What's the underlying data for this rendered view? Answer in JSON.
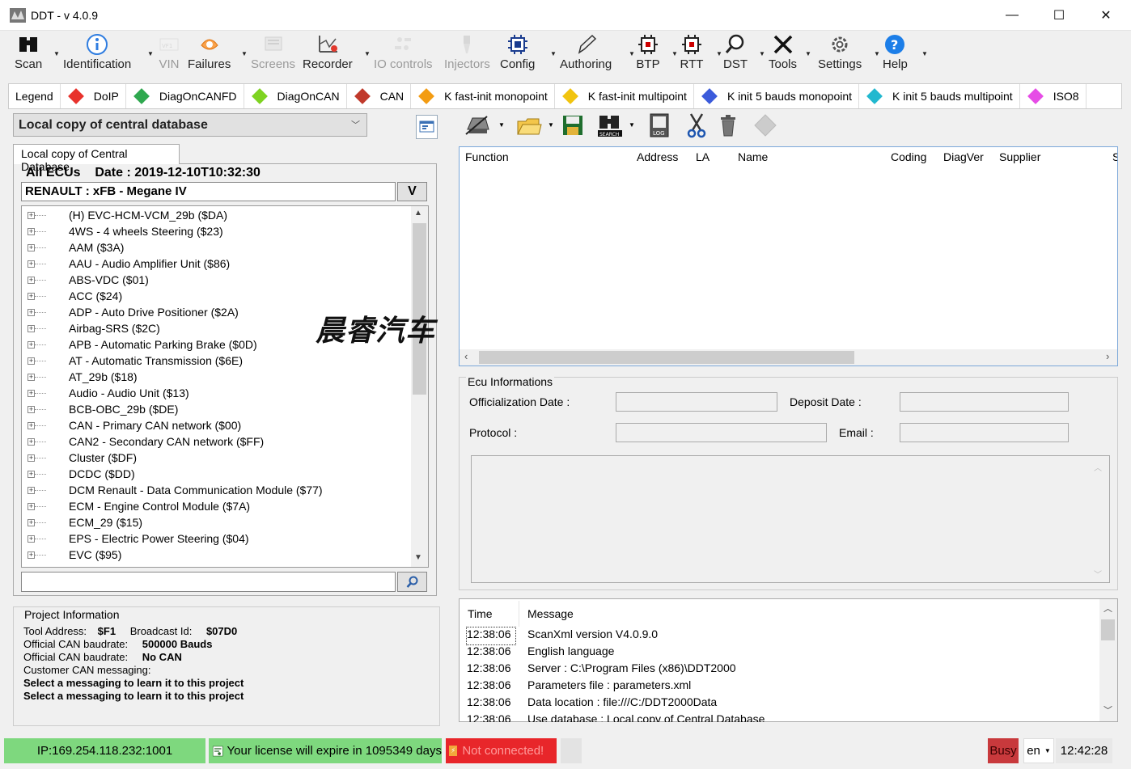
{
  "window": {
    "title": "DDT - v 4.0.9",
    "controls": {
      "minimize": "—",
      "maximize": "☐",
      "close": "✕"
    }
  },
  "toolbar": [
    {
      "label": "Scan",
      "icon": "binoculars-icon",
      "enabled": true
    },
    {
      "label": "Identification",
      "icon": "info-icon",
      "enabled": true
    },
    {
      "label": "VIN",
      "icon": "vin-card-icon",
      "enabled": false
    },
    {
      "label": "Failures",
      "icon": "failures-icon",
      "enabled": true
    },
    {
      "label": "Screens",
      "icon": "screens-icon",
      "enabled": false
    },
    {
      "label": "Recorder",
      "icon": "recorder-chart-icon",
      "enabled": true
    },
    {
      "label": "IO controls",
      "icon": "io-controls-icon",
      "enabled": false
    },
    {
      "label": "Injectors",
      "icon": "injector-icon",
      "enabled": false
    },
    {
      "label": "Config",
      "icon": "config-chip-icon",
      "enabled": true
    },
    {
      "label": "Authoring",
      "icon": "pen-icon",
      "enabled": true
    },
    {
      "label": "BTP",
      "icon": "btp-chip-icon",
      "enabled": true
    },
    {
      "label": "RTT",
      "icon": "rtt-chip-icon",
      "enabled": true
    },
    {
      "label": "DST",
      "icon": "magnifier-icon",
      "enabled": true
    },
    {
      "label": "Tools",
      "icon": "tools-icon",
      "enabled": true
    },
    {
      "label": "Settings",
      "icon": "gear-icon",
      "enabled": true
    },
    {
      "label": "Help",
      "icon": "help-icon",
      "enabled": true
    }
  ],
  "legend": {
    "title": "Legend",
    "items": [
      {
        "label": "DoIP",
        "color": "#e8322c"
      },
      {
        "label": "DiagOnCANFD",
        "color": "#2fa84f"
      },
      {
        "label": "DiagOnCAN",
        "color": "#7ed321"
      },
      {
        "label": "CAN",
        "color": "#c0392b"
      },
      {
        "label": "K fast-init monopoint",
        "color": "#f39c12"
      },
      {
        "label": "K fast-init multipoint",
        "color": "#f1c40f"
      },
      {
        "label": "K init 5 bauds monopoint",
        "color": "#3b5bdb"
      },
      {
        "label": "K init 5 bauds multipoint",
        "color": "#22b8cf"
      },
      {
        "label": "ISO8",
        "color": "#e64ce6"
      }
    ]
  },
  "database": {
    "selected": "Local copy of central database",
    "tab": "Local copy of Central Database",
    "header": "All ECUs    Date : 2019-12-10T10:32:30",
    "vehicle": "RENAULT : xFB - Megane IV",
    "vehicle_button": "V",
    "ecus": [
      "(H) EVC-HCM-VCM_29b ($DA)",
      "4WS - 4 wheels Steering ($23)",
      "AAM ($3A)",
      "AAU - Audio Amplifier Unit ($86)",
      "ABS-VDC ($01)",
      "ACC ($24)",
      "ADP - Auto Drive Positioner ($2A)",
      "Airbag-SRS ($2C)",
      "APB - Automatic Parking Brake ($0D)",
      "AT - Automatic Transmission ($6E)",
      "AT_29b ($18)",
      "Audio - Audio Unit ($13)",
      "BCB-OBC_29b ($DE)",
      "CAN - Primary CAN network ($00)",
      "CAN2 - Secondary CAN network ($FF)",
      "Cluster ($DF)",
      "DCDC ($DD)",
      "DCM Renault - Data Communication Module ($77)",
      "ECM - Engine Control Module ($7A)",
      "ECM_29 ($15)",
      "EPS - Electric Power Steering ($04)",
      "EVC ($95)"
    ],
    "search_value": ""
  },
  "watermark": "晨睿汽车",
  "project": {
    "title": "Project Information",
    "tool_address_label": "Tool Address:",
    "tool_address": "$F1",
    "broadcast_label": "Broadcast Id:",
    "broadcast": "$07D0",
    "official_can1_label": "Official CAN baudrate:",
    "official_can1": "500000 Bauds",
    "official_can2_label": "Official CAN baudrate:",
    "official_can2": "No CAN",
    "customer_label": "Customer CAN messaging:",
    "line1": "Select a messaging to learn it to this project",
    "line2": "Select a messaging to learn it to this project"
  },
  "ecu_list": {
    "columns": [
      "Function",
      "Address",
      "LA",
      "Name",
      "Coding",
      "DiagVer",
      "Supplier",
      "S"
    ],
    "rows": []
  },
  "ecu_info": {
    "title": "Ecu Informations",
    "official_date_label": "Officialization Date :",
    "deposit_date_label": "Deposit Date :",
    "protocol_label": "Protocol :",
    "email_label": "Email :",
    "official_date": "",
    "deposit_date": "",
    "protocol": "",
    "email": ""
  },
  "log": {
    "columns": [
      "Time",
      "Message"
    ],
    "rows": [
      {
        "time": "12:38:06",
        "message": "ScanXml version V4.0.9.0"
      },
      {
        "time": "12:38:06",
        "message": "English language"
      },
      {
        "time": "12:38:06",
        "message": "Server : C:\\Program Files (x86)\\DDT2000"
      },
      {
        "time": "12:38:06",
        "message": "Parameters file : parameters.xml"
      },
      {
        "time": "12:38:06",
        "message": "Data location : file:///C:/DDT2000Data"
      },
      {
        "time": "12:38:06",
        "message": "Use database : Local copy of Central Database"
      }
    ]
  },
  "status": {
    "ip": "IP:169.254.118.232:1001",
    "license": "Your license will expire in 1095349 days",
    "connection": "Not connected!",
    "busy": "Busy",
    "language": "en",
    "clock": "12:42:28"
  },
  "colors": {
    "status_green": "#7ed87e",
    "status_red": "#e8262a",
    "busy_red": "#c8393c",
    "accent_blue": "#7aa7d9"
  }
}
